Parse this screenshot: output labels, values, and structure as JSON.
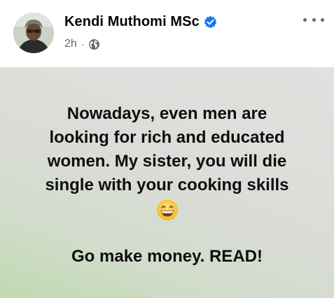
{
  "post": {
    "author": {
      "name": "Kendi Muthomi MSc",
      "verified": true
    },
    "timestamp": "2h",
    "separator": "·",
    "audience_icon": "globe-icon",
    "body": {
      "lines": [
        "Nowadays, even men are",
        "looking for rich and educated",
        "women. My sister, you will die",
        "single with your cooking skills"
      ],
      "emoji": "grinning-face-with-smiling-eyes",
      "cta": "Go make money. READ!"
    }
  },
  "colors": {
    "verified_blue": "#1877f2",
    "meta_gray": "#65676b",
    "text": "#050505"
  }
}
